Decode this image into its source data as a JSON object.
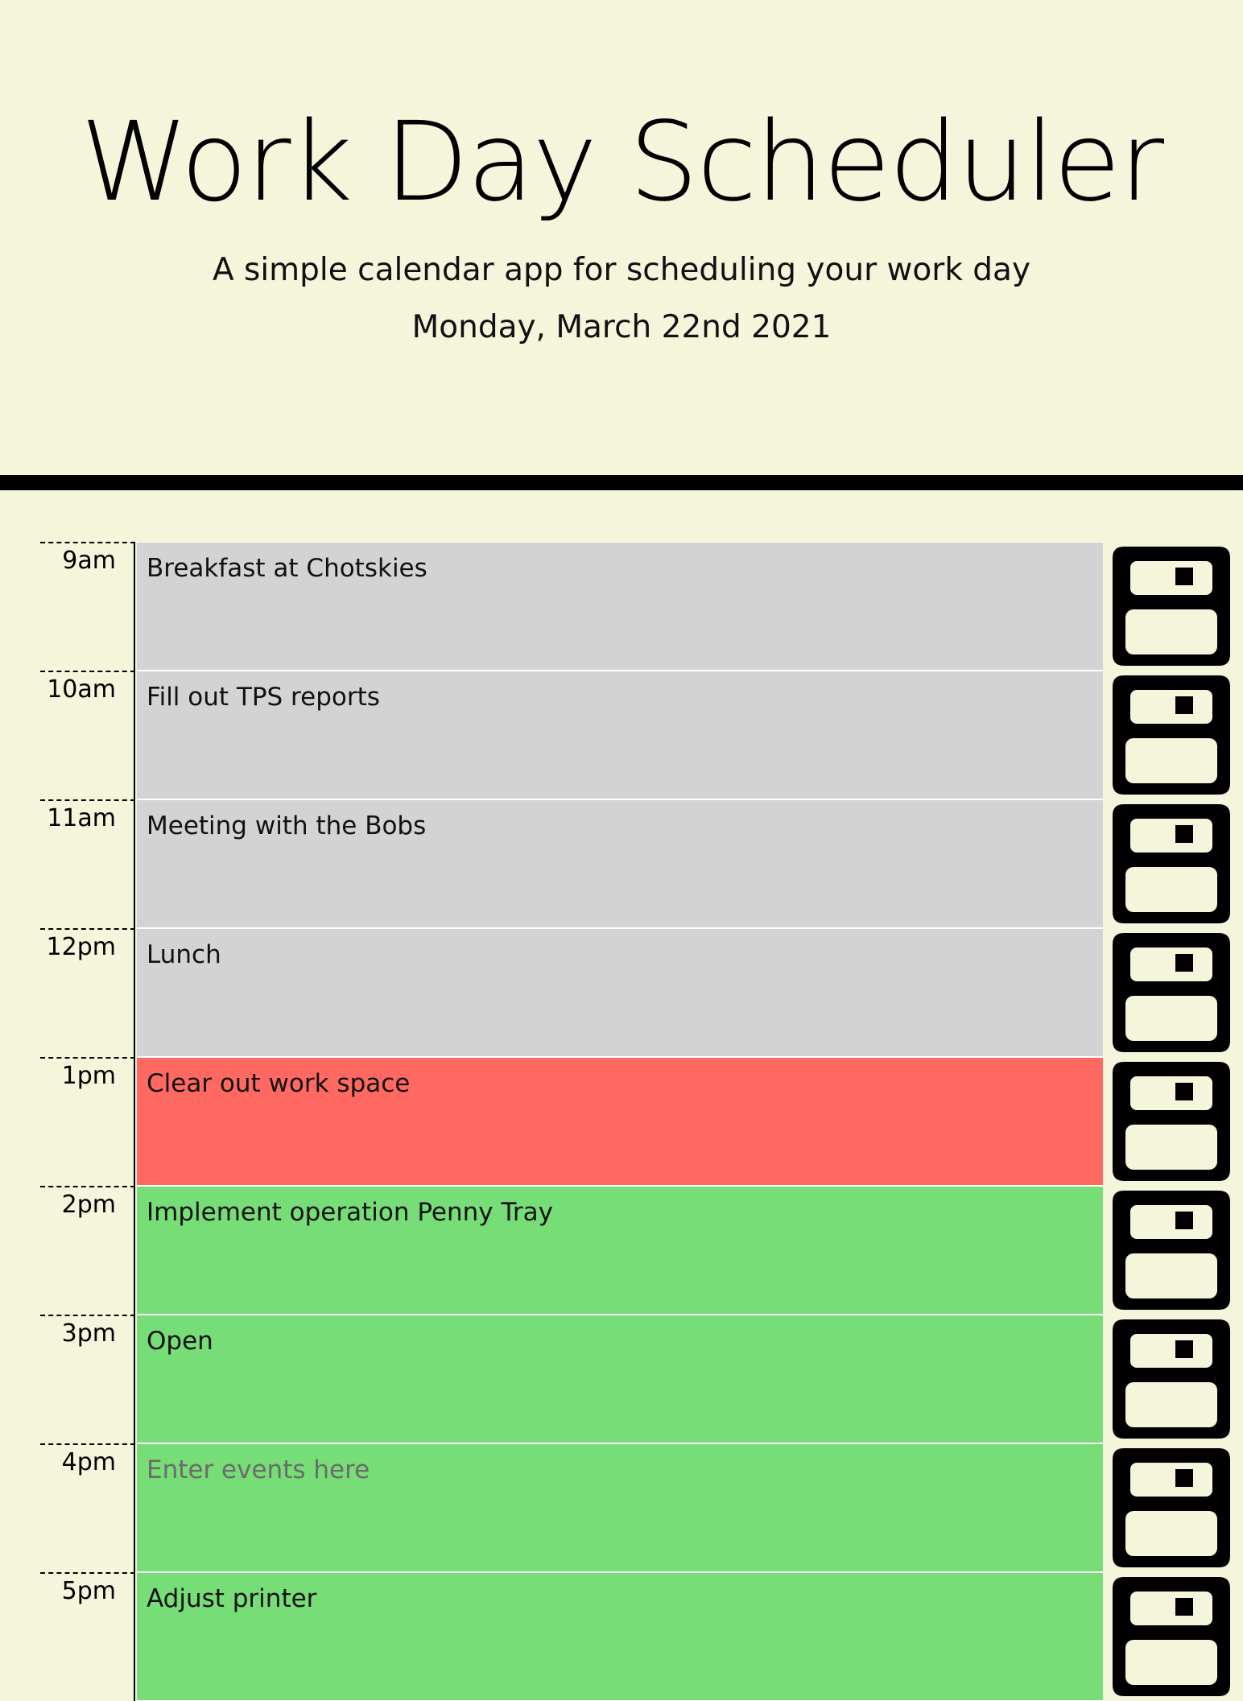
{
  "header": {
    "title": "Work Day Scheduler",
    "subtitle": "A simple calendar app for scheduling your work day",
    "current_day": "Monday, March 22nd 2021"
  },
  "colors": {
    "background": "#f5f5dc",
    "past": "#d3d3d3",
    "present": "#ff6961",
    "future": "#77dd77",
    "divider": "#000000"
  },
  "schedule": {
    "placeholder": "Enter events here",
    "rows": [
      {
        "hour": "9am",
        "value": "Breakfast at Chotskies",
        "state": "past"
      },
      {
        "hour": "10am",
        "value": "Fill out TPS reports",
        "state": "past"
      },
      {
        "hour": "11am",
        "value": "Meeting with the Bobs",
        "state": "past"
      },
      {
        "hour": "12pm",
        "value": "Lunch",
        "state": "past"
      },
      {
        "hour": "1pm",
        "value": "Clear out work space",
        "state": "present"
      },
      {
        "hour": "2pm",
        "value": "Implement operation Penny Tray",
        "state": "future"
      },
      {
        "hour": "3pm",
        "value": "Open",
        "state": "future"
      },
      {
        "hour": "4pm",
        "value": "",
        "state": "future"
      },
      {
        "hour": "5pm",
        "value": "Adjust printer",
        "state": "future"
      }
    ],
    "save_icon": "floppy-disk-icon"
  }
}
